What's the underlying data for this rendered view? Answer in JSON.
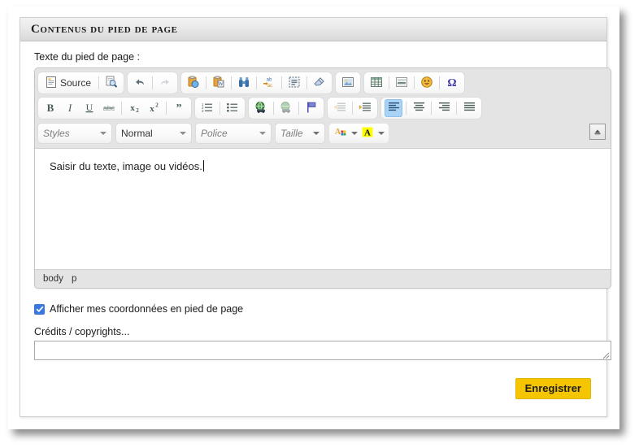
{
  "panel": {
    "header_title": "Contenus du pied de page"
  },
  "editor_field": {
    "label": "Texte du pied de page :",
    "content": "Saisir du texte, image ou vidéos.",
    "status_path": [
      "body",
      "p"
    ]
  },
  "toolbar": {
    "row1": [
      {
        "name": "source-button",
        "label": "Source",
        "icon": "source-document-icon",
        "type": "text"
      },
      {
        "name": "preview-button",
        "label": "",
        "icon": "preview-magnifier-icon",
        "type": "icon"
      },
      {
        "name": "undo-button",
        "label": "",
        "icon": "undo-arrow-icon",
        "type": "icon"
      },
      {
        "name": "redo-button",
        "label": "",
        "icon": "redo-arrow-icon",
        "type": "icon",
        "disabled": true
      },
      {
        "name": "paste-button",
        "label": "",
        "icon": "paste-clipboard-icon",
        "type": "icon"
      },
      {
        "name": "paste-from-word-button",
        "label": "",
        "icon": "paste-word-icon",
        "type": "icon"
      },
      {
        "name": "find-button",
        "label": "",
        "icon": "binoculars-find-icon",
        "type": "icon"
      },
      {
        "name": "replace-button",
        "label": "",
        "icon": "replace-abc-icon",
        "type": "icon"
      },
      {
        "name": "select-all-button",
        "label": "",
        "icon": "select-all-icon",
        "type": "icon"
      },
      {
        "name": "remove-format-button",
        "label": "",
        "icon": "eraser-icon",
        "type": "icon"
      },
      {
        "name": "image-button",
        "label": "",
        "icon": "image-icon",
        "type": "icon"
      },
      {
        "name": "table-button",
        "label": "",
        "icon": "table-icon",
        "type": "icon"
      },
      {
        "name": "horizontal-rule-button",
        "label": "",
        "icon": "horizontal-rule-icon",
        "type": "icon"
      },
      {
        "name": "smiley-button",
        "label": "",
        "icon": "smiley-icon",
        "type": "icon"
      },
      {
        "name": "special-char-button",
        "label": "",
        "icon": "omega-icon",
        "type": "icon"
      }
    ],
    "row2": [
      {
        "name": "bold-button",
        "icon": "bold-icon"
      },
      {
        "name": "italic-button",
        "icon": "italic-icon"
      },
      {
        "name": "underline-button",
        "icon": "underline-icon"
      },
      {
        "name": "strikethrough-button",
        "icon": "strikethrough-icon"
      },
      {
        "name": "subscript-button",
        "icon": "subscript-icon"
      },
      {
        "name": "superscript-button",
        "icon": "superscript-icon"
      },
      {
        "name": "blockquote-button",
        "icon": "quote-icon"
      },
      {
        "name": "numbered-list-button",
        "icon": "numbered-list-icon"
      },
      {
        "name": "bulleted-list-button",
        "icon": "bulleted-list-icon"
      },
      {
        "name": "link-button",
        "icon": "link-globe-icon"
      },
      {
        "name": "unlink-button",
        "icon": "unlink-globe-icon"
      },
      {
        "name": "anchor-button",
        "icon": "anchor-flag-icon"
      },
      {
        "name": "outdent-button",
        "icon": "outdent-icon",
        "disabled": true
      },
      {
        "name": "indent-button",
        "icon": "indent-icon"
      },
      {
        "name": "align-left-button",
        "icon": "align-left-icon",
        "active": true
      },
      {
        "name": "align-center-button",
        "icon": "align-center-icon"
      },
      {
        "name": "align-right-button",
        "icon": "align-right-icon"
      },
      {
        "name": "align-justify-button",
        "icon": "align-justify-icon"
      }
    ],
    "combos": [
      {
        "name": "styles-combo",
        "label": "Styles",
        "selected": false
      },
      {
        "name": "format-combo",
        "label": "Normal",
        "selected": true
      },
      {
        "name": "font-combo",
        "label": "Police",
        "selected": false
      },
      {
        "name": "size-combo",
        "label": "Taille",
        "selected": false
      }
    ],
    "colors": [
      {
        "name": "text-color-button",
        "icon": "text-color-icon"
      },
      {
        "name": "background-color-button",
        "icon": "background-color-icon"
      }
    ],
    "collapse_button": {
      "name": "toolbar-collapse-button",
      "icon": "collapse-toolbar-icon"
    }
  },
  "options": {
    "show_contact_checkbox": {
      "label": "Afficher mes coordonnées en pied de page",
      "checked": true
    }
  },
  "credits": {
    "label": "Crédits / copyrights...",
    "value": "",
    "placeholder": ""
  },
  "actions": {
    "save_label": "Enregistrer"
  },
  "colors": {
    "accent_yellow": "#f5c600",
    "checkbox_blue": "#3b77dd",
    "active_toolbar_blue": "#a8d3f7",
    "toolbar_grey": "#e4e4e4",
    "header_grey": "#e9e9e9"
  }
}
